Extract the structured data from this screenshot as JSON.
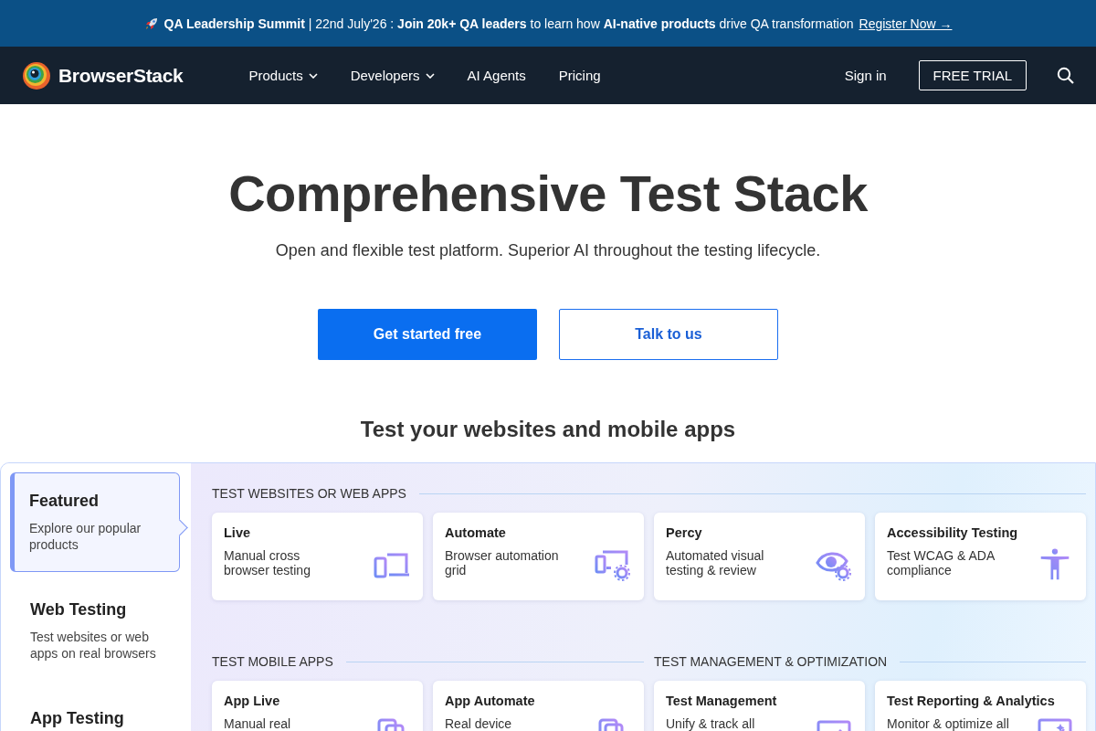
{
  "banner": {
    "text": "**QA Leadership Summit** | 22nd July'26 : **Join 20k+ QA leaders** to learn how **AI-native products** drive QA transformation",
    "link": "Register Now →"
  },
  "nav": {
    "brand": "BrowserStack",
    "items": [
      {
        "label": "Products",
        "dropdown": true
      },
      {
        "label": "Developers",
        "dropdown": true
      },
      {
        "label": "AI Agents",
        "dropdown": false
      },
      {
        "label": "Pricing",
        "dropdown": false
      }
    ],
    "sign_in": "Sign in",
    "trial": "FREE TRIAL"
  },
  "hero": {
    "title": "Comprehensive Test Stack",
    "subtitle": "Open and flexible test platform. Superior AI throughout the testing lifecycle.",
    "primary": "Get started free",
    "secondary": "Talk to us"
  },
  "section_title": "Test your websites and mobile apps",
  "sidebar": [
    {
      "title": "Featured",
      "description": "Explore our popular products",
      "selected": true
    },
    {
      "title": "Web Testing",
      "description": "Test websites or web apps on real browsers",
      "selected": false
    },
    {
      "title": "App Testing",
      "selected": false
    }
  ],
  "groups": [
    {
      "heading": "TEST WEBSITES OR WEB APPS",
      "cards": [
        {
          "title": "Live",
          "description": "Manual cross browser testing",
          "kind": "devices"
        },
        {
          "title": "Automate",
          "description": "Browser automation grid",
          "kind": "automation"
        },
        {
          "title": "Percy",
          "description": "Automated visual testing & review",
          "kind": "eye"
        },
        {
          "title": "Accessibility Testing",
          "description": "Test WCAG & ADA compliance",
          "kind": "person"
        }
      ]
    },
    {
      "heading": "TEST MOBILE APPS",
      "cards": [
        {
          "title": "App Live",
          "description": "Manual real",
          "kind": "phones"
        },
        {
          "title": "App Automate",
          "description": "Real device",
          "kind": "phone-gear"
        }
      ]
    },
    {
      "heading": "TEST MANAGEMENT & OPTIMIZATION",
      "cards": [
        {
          "title": "Test Management",
          "description": "Unify & track all",
          "kind": "board"
        },
        {
          "title": "Test Reporting & Analytics",
          "description": "Monitor & optimize all",
          "kind": "chart"
        }
      ]
    }
  ]
}
